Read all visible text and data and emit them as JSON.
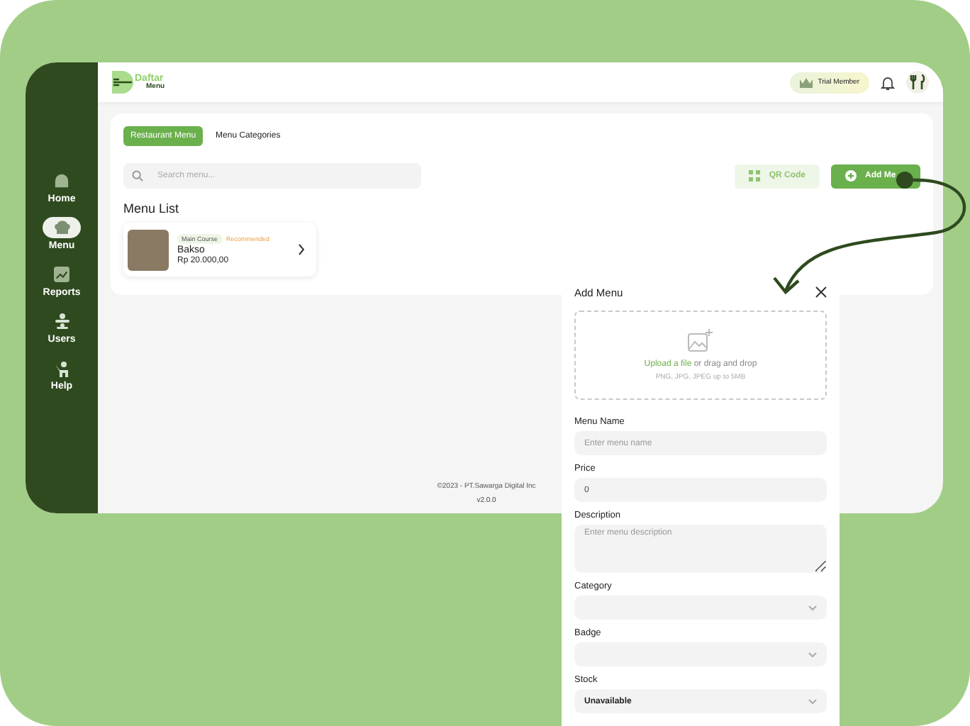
{
  "brand": {
    "line_1": "Daftar",
    "line_2": "Menu"
  },
  "sidebar": {
    "items": [
      {
        "label": "Home",
        "selected": false
      },
      {
        "label": "Menu",
        "selected": true
      },
      {
        "label": "Reports",
        "selected": false
      },
      {
        "label": "Users",
        "selected": false
      },
      {
        "label": "Help",
        "selected": false
      }
    ]
  },
  "header": {
    "badge": "Trial Member"
  },
  "tabs": [
    {
      "label": "Restaurant Menu",
      "selected": true
    },
    {
      "label": "Menu Categories",
      "selected": false
    }
  ],
  "search": {
    "placeholder": "Search menu..."
  },
  "actions": {
    "qr_button": "QR Code",
    "add_button": "Add Me"
  },
  "menu_list": {
    "title": "Menu List",
    "items": [
      {
        "category": "Main Course",
        "badge": "Recommended",
        "name": "Bakso",
        "price": "Rp 20.000,00"
      }
    ]
  },
  "footer": {
    "copyright": "©2023 - PT.Sawarga Digital Inc",
    "version": "v2.0.0"
  },
  "add_menu_panel": {
    "title": "Add Menu",
    "upload_text": "**Upload a file** or drag and drop",
    "upload_hint": "PNG, JPG, JPEG up to 5MB",
    "fields": [
      {
        "kind": "text",
        "label": "Menu Name",
        "placeholder": "Enter menu name"
      },
      {
        "kind": "text",
        "label": "Price",
        "value": "0"
      },
      {
        "kind": "textarea",
        "label": "Description",
        "placeholder": "Enter menu description"
      },
      {
        "kind": "select",
        "label": "Category"
      },
      {
        "kind": "select",
        "label": "Badge"
      },
      {
        "kind": "select",
        "label": "Stock",
        "value": "Unavailable"
      }
    ]
  }
}
